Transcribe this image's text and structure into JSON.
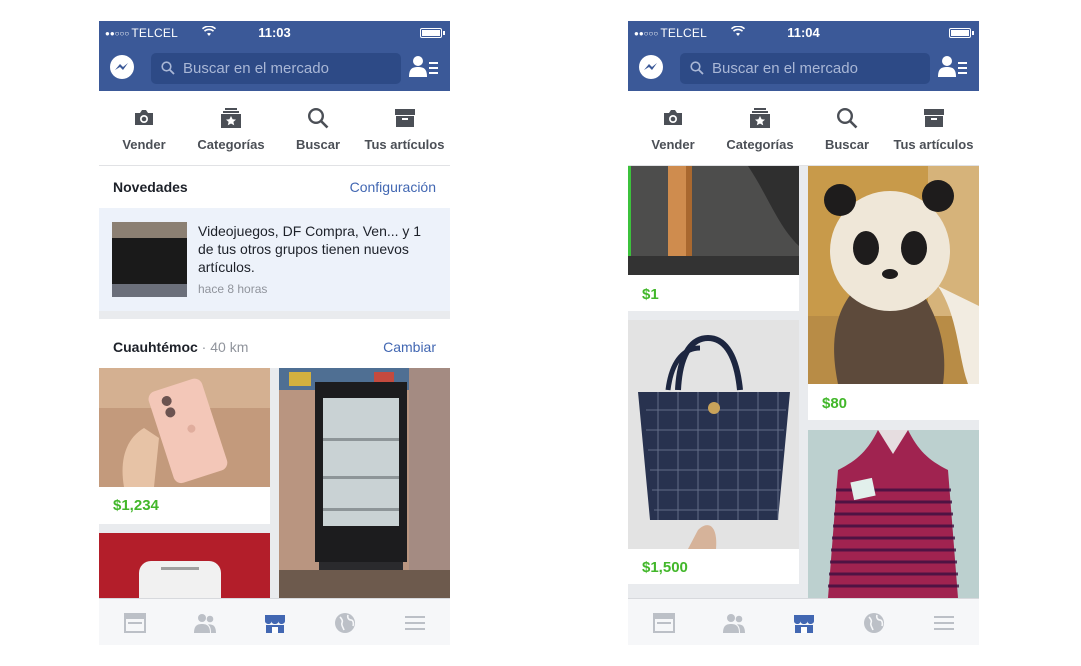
{
  "colors": {
    "brand": "#3b5998",
    "price": "#42b72a",
    "link": "#4267b2",
    "active_tab": "#4267b2",
    "inactive_tab": "#bcc0c7"
  },
  "status": {
    "carrier": "TELCEL"
  },
  "search": {
    "placeholder": "Buscar en el mercado"
  },
  "nav": {
    "sell": "Vender",
    "categories": "Categorías",
    "search": "Buscar",
    "your_items": "Tus artículos"
  },
  "screens": [
    {
      "time": "11:03",
      "news": {
        "title": "Novedades",
        "action": "Configuración"
      },
      "notification": {
        "text": "Videojuegos, DF Compra, Ven... y 1 de tus otros grupos tienen nuevos artículos.",
        "time": "hace 8 horas"
      },
      "location": {
        "city": "Cuauhtémoc",
        "distance": "40 km",
        "action": "Cambiar"
      },
      "listings": [
        {
          "price": "$1,234",
          "image": "rose-gold-phone"
        },
        {
          "price": "",
          "image": "display-fridge"
        },
        {
          "price": "",
          "image": "white-phone"
        }
      ]
    },
    {
      "time": "11:04",
      "listings": [
        {
          "price": "$1",
          "image": "wood-chair"
        },
        {
          "price": "$80",
          "image": "panda-hat"
        },
        {
          "price": "$1,500",
          "image": "navy-handbag"
        },
        {
          "price": "",
          "image": "striped-dress"
        }
      ]
    }
  ],
  "bottom_tabs": [
    "news-feed-icon",
    "friends-icon",
    "marketplace-icon",
    "globe-icon",
    "menu-icon"
  ],
  "active_bottom_tab": "marketplace-icon"
}
